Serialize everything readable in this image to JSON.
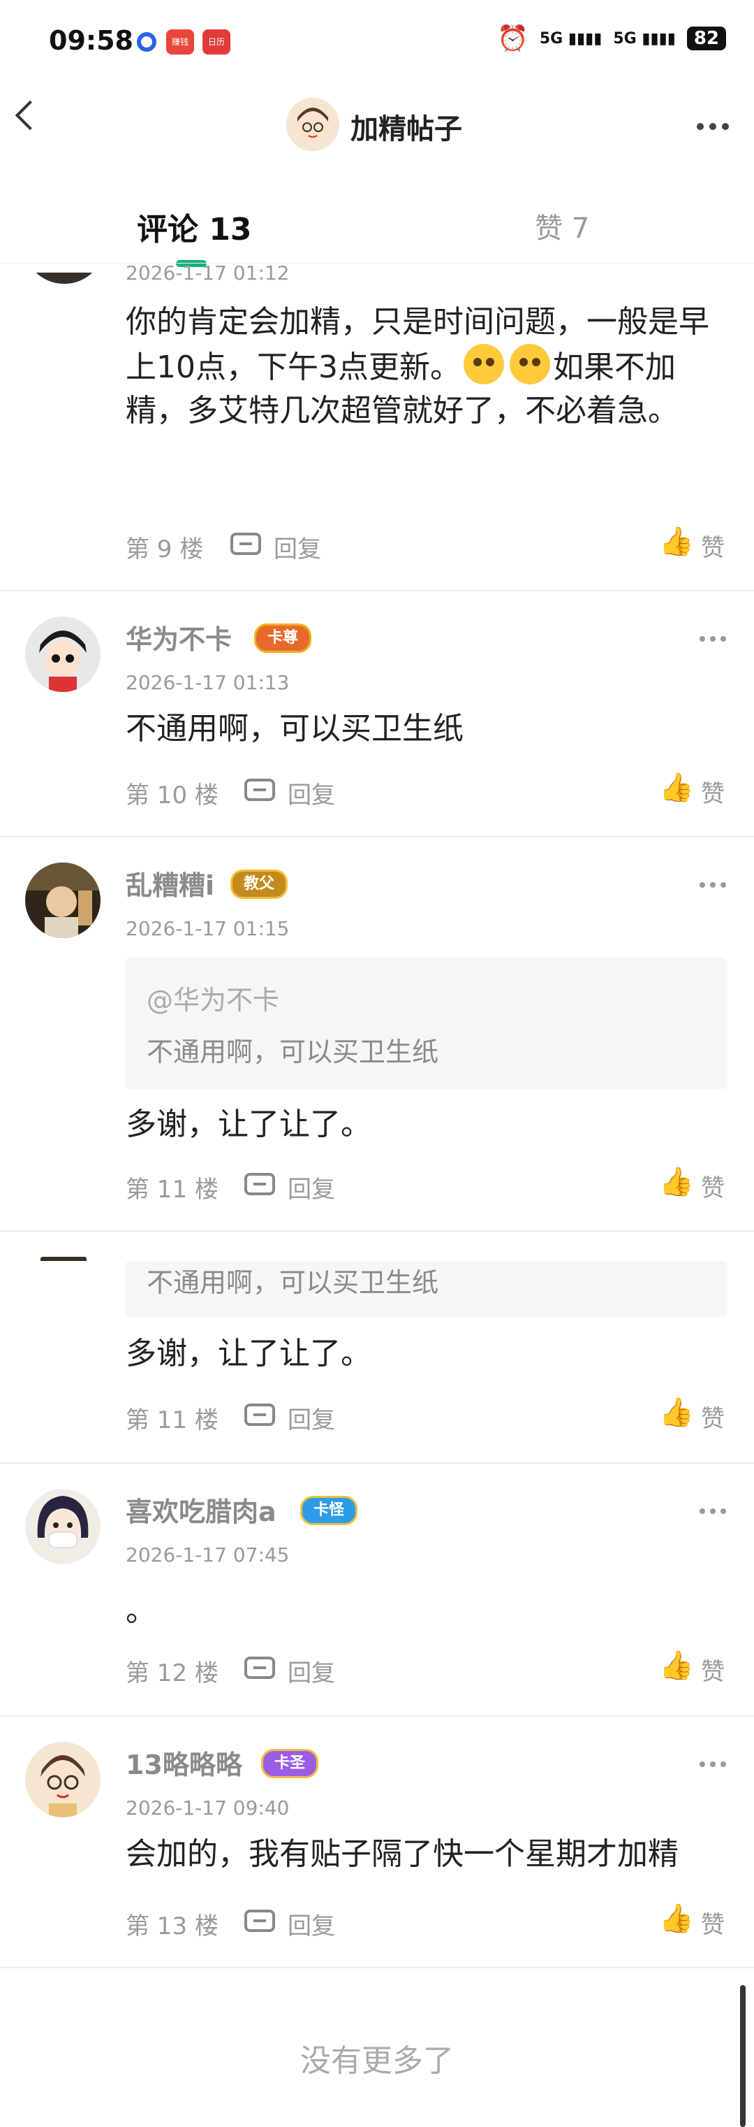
{
  "status_bar": {
    "time": "09:58",
    "app1": "赚钱",
    "app2": "日历",
    "signal1": "5G",
    "signal2": "5G",
    "battery": "82"
  },
  "header": {
    "title": "加精帖子"
  },
  "tabs": {
    "comments": "评论 13",
    "likes": "赞 7"
  },
  "labels": {
    "reply": "回复",
    "like": "赞"
  },
  "posts": [
    {
      "time": "2026-1-17 01:12",
      "text_a": "你的肯定会加精，只是时间问题，一般是早上10点，下午3点更新。",
      "text_b": "如果不加精，多艾特几次超管就好了，不必着急。",
      "floor": "第 9 楼"
    },
    {
      "user": "华为不卡",
      "badge": "卡尊",
      "time": "2026-1-17 01:13",
      "text": "不通用啊，可以买卫生纸",
      "floor": "第 10 楼"
    },
    {
      "user": "乱糟糟i",
      "badge": "教父",
      "time": "2026-1-17 01:15",
      "quote_user": "@华为不卡",
      "quote_text": "不通用啊，可以买卫生纸",
      "text": "多谢，让了让了。",
      "floor": "第 11 楼"
    },
    {
      "quote_text": "不通用啊，可以买卫生纸",
      "text": "多谢，让了让了。",
      "floor": "第 11 楼"
    },
    {
      "user": "喜欢吃腊肉a",
      "badge": "卡怪",
      "time": "2026-1-17 07:45",
      "text": "。",
      "floor": "第 12 楼"
    },
    {
      "user": "13略略略",
      "badge": "卡圣",
      "time": "2026-1-17 09:40",
      "text": "会加的，我有贴子隔了快一个星期才加精",
      "floor": "第 13 楼"
    }
  ],
  "footer": {
    "no_more": "没有更多了"
  },
  "colors": {
    "accent": "#17b07b",
    "badge_gold": "#e8a317",
    "badge_blue": "#2e9be6",
    "badge_purple": "#9b5de5"
  }
}
